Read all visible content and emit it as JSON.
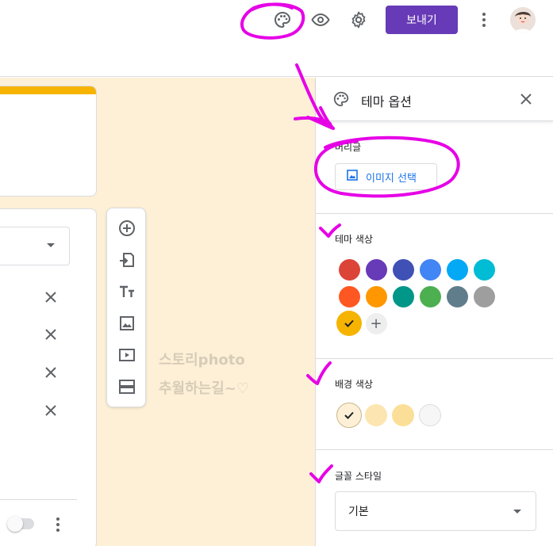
{
  "toolbar": {
    "send_label": "보내기",
    "icons": [
      "palette-icon",
      "eye-icon",
      "gear-icon",
      "more-vert-icon"
    ]
  },
  "panel": {
    "title": "테마 옵션",
    "header_section": {
      "label": "머리글",
      "image_button": "이미지 선택"
    },
    "theme_color_section": {
      "label": "테마 색상",
      "colors": [
        "#db4437",
        "#673ab7",
        "#3f51b5",
        "#4285f4",
        "#03a9f4",
        "#00bcd4",
        "#ff5722",
        "#ff9800",
        "#009688",
        "#4caf50",
        "#607d8b",
        "#9e9e9e",
        "#f6b400"
      ],
      "selected_color": "#f6b400",
      "add_label": "+"
    },
    "background_color_section": {
      "label": "배경 색상",
      "colors": [
        "#fdf0d6",
        "#fce5b0",
        "#fbdf98",
        "#f6f6f6"
      ],
      "selected_color": "#fdf0d6"
    },
    "font_style_section": {
      "label": "글꼴 스타일",
      "value": "기본"
    }
  },
  "watermark": {
    "line1": "스토리photo",
    "line2": "추월하는길~♡"
  },
  "accent_color": "#673ab7",
  "annotation_color": "#e600e6"
}
